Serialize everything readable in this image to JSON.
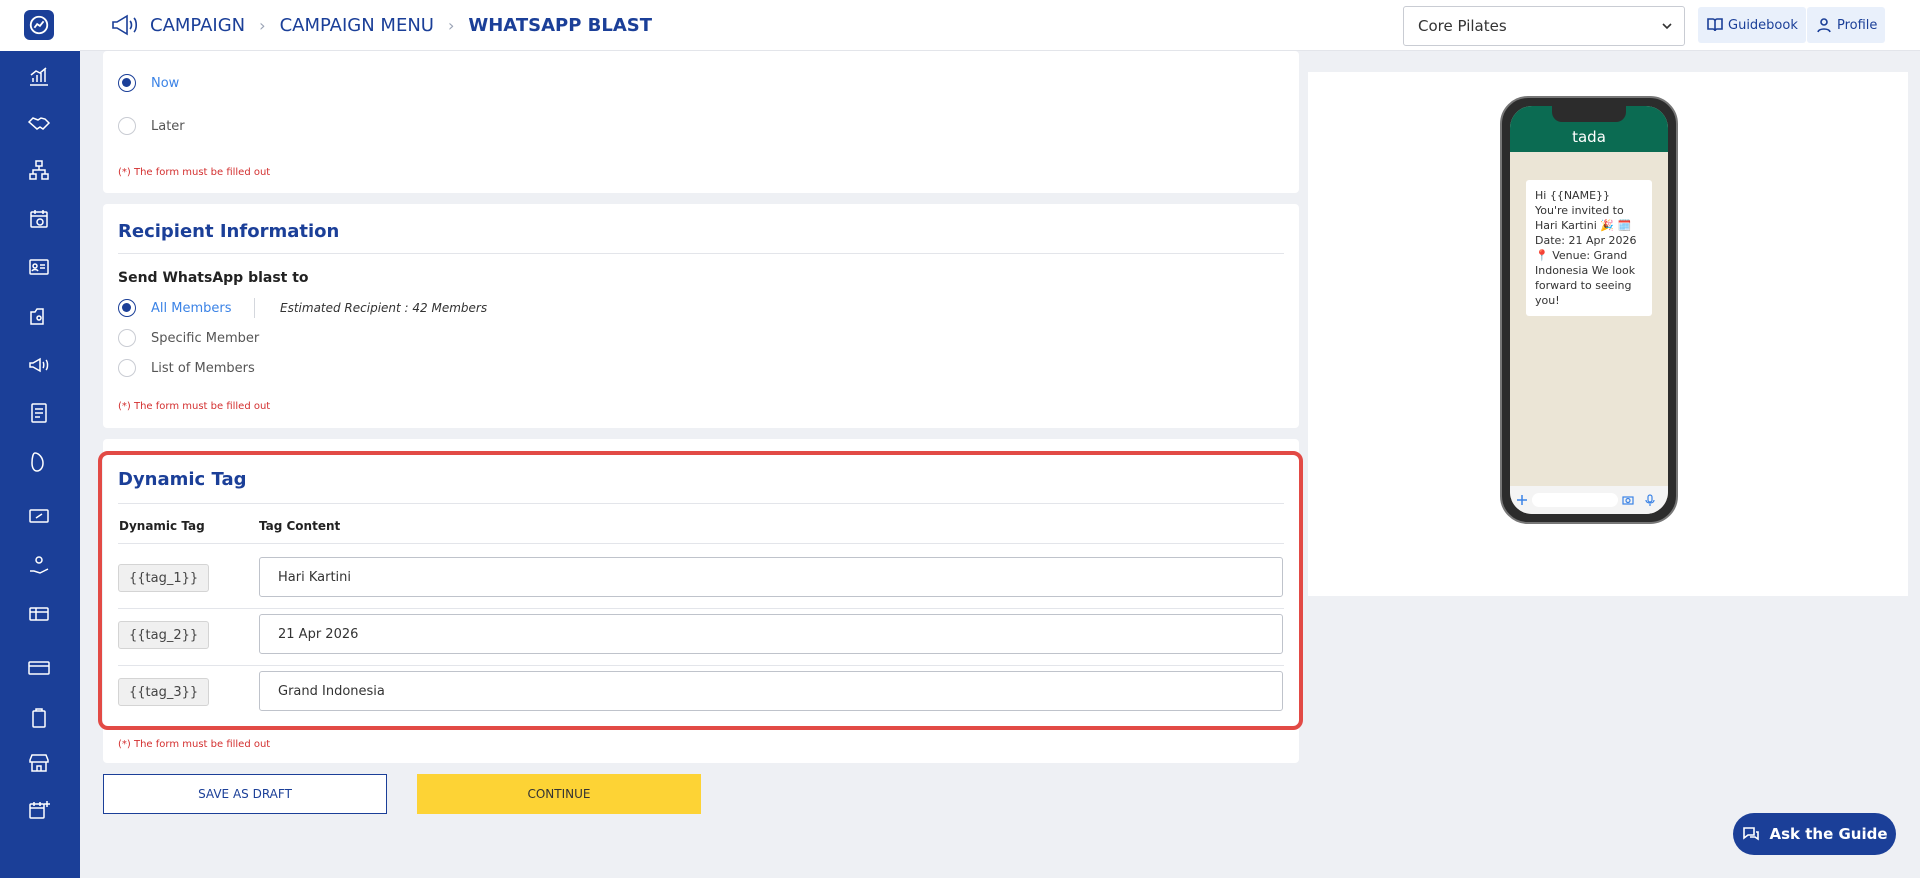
{
  "breadcrumbs": [
    "CAMPAIGN",
    "CAMPAIGN MENU",
    "WHATSAPP BLAST"
  ],
  "header": {
    "studio_select": "Core Pilates",
    "guidebook_label": "Guidebook",
    "profile_label": "Profile"
  },
  "schedule": {
    "options": [
      "Now",
      "Later"
    ],
    "selected": "Now",
    "required_note": "(*) The form must be filled out"
  },
  "recipient": {
    "title": "Recipient Information",
    "send_label": "Send WhatsApp blast to",
    "options": [
      "All Members",
      "Specific Member",
      "List of Members"
    ],
    "selected": "All Members",
    "estimated": "Estimated Recipient : 42 Members",
    "required_note": "(*) The form must be filled out"
  },
  "dynamic_tag": {
    "title": "Dynamic Tag",
    "col_tag": "Dynamic Tag",
    "col_content": "Tag Content",
    "rows": [
      {
        "tag": "{{tag_1}}",
        "content": "Hari Kartini"
      },
      {
        "tag": "{{tag_2}}",
        "content": "21 Apr 2026"
      },
      {
        "tag": "{{tag_3}}",
        "content": "Grand Indonesia"
      }
    ],
    "required_note": "(*) The form must be filled out"
  },
  "actions": {
    "save_draft": "SAVE AS DRAFT",
    "continue": "CONTINUE"
  },
  "preview": {
    "app_name": "tada",
    "message": "Hi {{NAME}} You're invited to Hari Kartini 🎉 🗓️ Date: 21 Apr 2026 📍 Venue: Grand Indonesia We look forward to seeing you!"
  },
  "ask_guide": "Ask the Guide",
  "colors": {
    "brand": "#1b3f98",
    "accent": "#fdd335",
    "error": "#d32f2f",
    "highlight": "#e24a45",
    "whatsapp": "#0b6b52"
  }
}
